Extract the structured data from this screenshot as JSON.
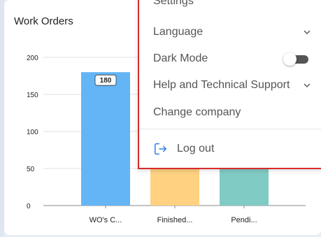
{
  "card": {
    "title": "Work Orders"
  },
  "chart_data": {
    "type": "bar",
    "categories": [
      "WO's C...",
      "Finished...",
      "Pendi..."
    ],
    "values": [
      180,
      null,
      null
    ],
    "value_labels": [
      "180",
      "",
      ""
    ],
    "yticks": [
      0,
      50,
      100,
      150,
      200
    ],
    "ylim": [
      0,
      200
    ],
    "colors": [
      "#64b5f6",
      "#ffd180",
      "#80cbc4"
    ],
    "grid": true,
    "title": "",
    "xlabel": "",
    "ylabel": ""
  },
  "menu": {
    "settings": "Settings",
    "language": "Language",
    "dark_mode": "Dark Mode",
    "dark_mode_on": false,
    "help": "Help and Technical Support",
    "change_company": "Change company",
    "logout": "Log out"
  },
  "colors": {
    "menu_border": "#d82b2b",
    "logout_icon": "#2f7fe0"
  }
}
